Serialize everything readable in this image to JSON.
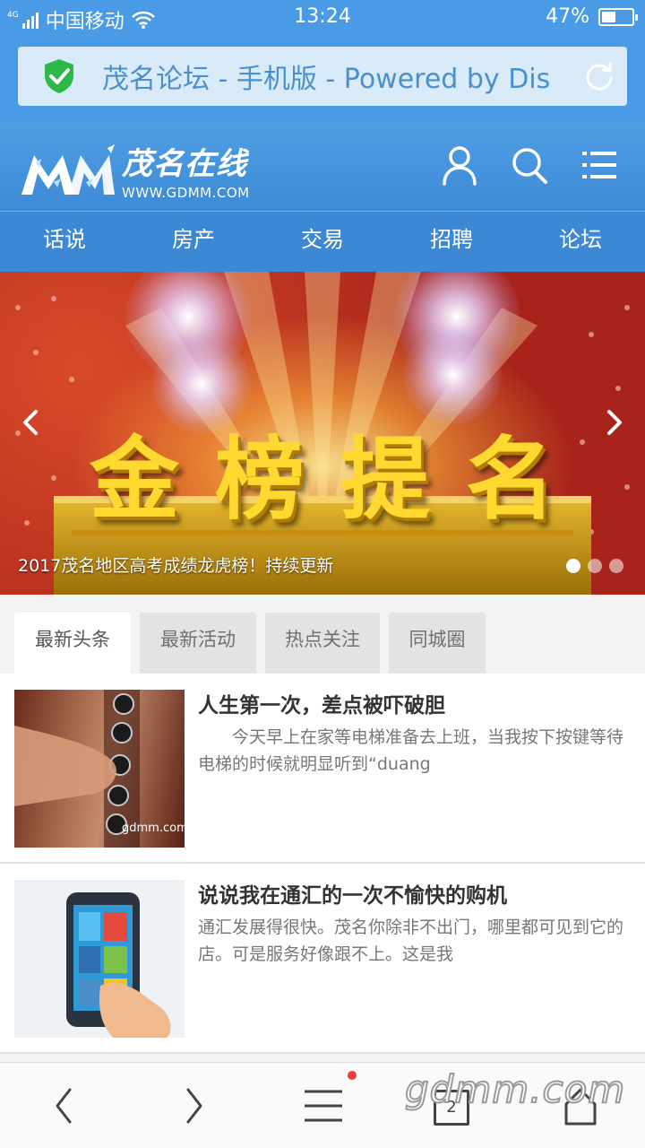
{
  "status_bar": {
    "network_tag": "4G",
    "carrier": "中国移动",
    "time": "13:24",
    "battery_percent": "47%",
    "battery_level": 0.47
  },
  "address_bar": {
    "page_title": "茂名论坛 - 手机版 - Powered by Dis",
    "secure_color": "#2db84a"
  },
  "site_header": {
    "logo_cn": "茂名在线",
    "logo_url_text": "WWW.GDMM.COM",
    "icons": [
      "user-icon",
      "search-icon",
      "menu-icon"
    ]
  },
  "nav": {
    "items": [
      "话说",
      "房产",
      "交易",
      "招聘",
      "论坛"
    ]
  },
  "banner": {
    "headline_chars": [
      "金",
      "榜",
      "提",
      "名"
    ],
    "caption": "2017茂名地区高考成绩龙虎榜！持续更新",
    "slide_count": 3,
    "active_slide": 1
  },
  "tabs": {
    "items": [
      "最新头条",
      "最新活动",
      "热点关注",
      "同城圈"
    ],
    "active": 0
  },
  "news": [
    {
      "title": "人生第一次，差点被吓破胆",
      "summary": "　　今天早上在家等电梯准备去上班，当我按下按键等待电梯的时候就明显听到“duang",
      "thumb_caption": "gdmm.com"
    },
    {
      "title": "说说我在通汇的一次不愉快的购机",
      "summary": "通汇发展得很快。茂名你除非不出门，哪里都可见到它的店。可是服务好像跟不上。这是我"
    }
  ],
  "bottom_bar": {
    "tab_count": "2",
    "watermark": "gdmm.com",
    "icons": [
      "back-icon",
      "forward-icon",
      "menu-icon",
      "tabs-icon",
      "home-icon"
    ]
  },
  "theme": {
    "primary": "#4a9be6",
    "nav": "#3d88d4"
  }
}
